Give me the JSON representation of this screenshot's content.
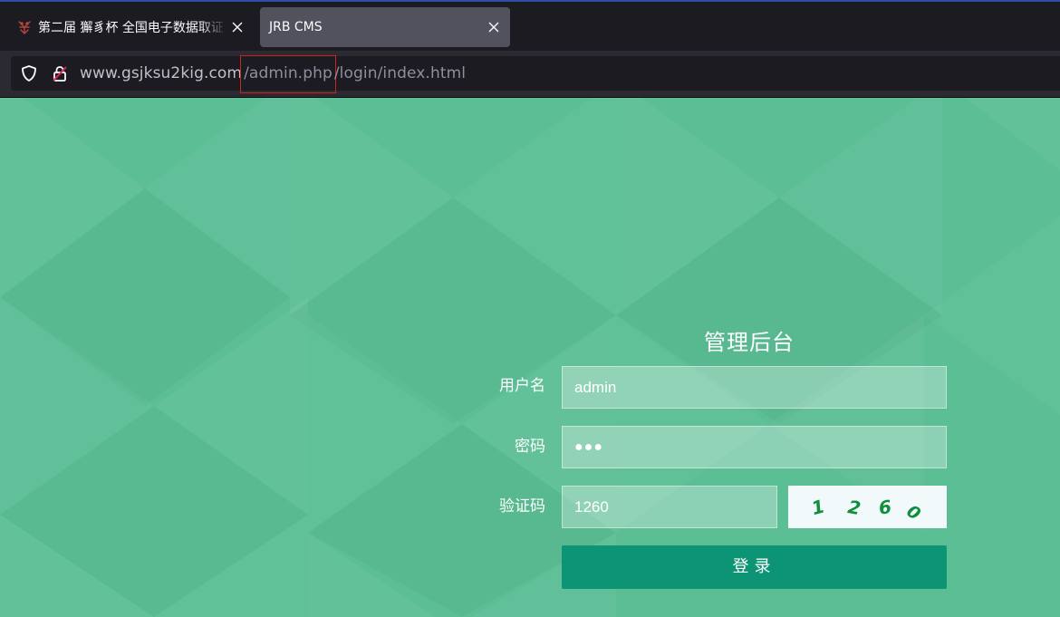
{
  "browser": {
    "tabs": [
      {
        "title": "第二届 獬豸杯 全国电子数据取证",
        "active": false
      },
      {
        "title": "JRB CMS",
        "active": true
      }
    ],
    "url": {
      "host": "www.gsjksu2kig.com",
      "highlighted_path": "/admin.php",
      "rest_path": "/login/index.html"
    }
  },
  "login": {
    "title": "管理后台",
    "username_label": "用户名",
    "username_value": "admin",
    "password_label": "密码",
    "password_value": "●●●",
    "captcha_label": "验证码",
    "captcha_value": "1260",
    "captcha_image_digits": [
      "1",
      "2",
      "6",
      "0"
    ],
    "submit_label": "登录"
  },
  "colors": {
    "page_background": "#5bbe95",
    "button": "#0d9474",
    "highlight_box": "#d3211c"
  }
}
